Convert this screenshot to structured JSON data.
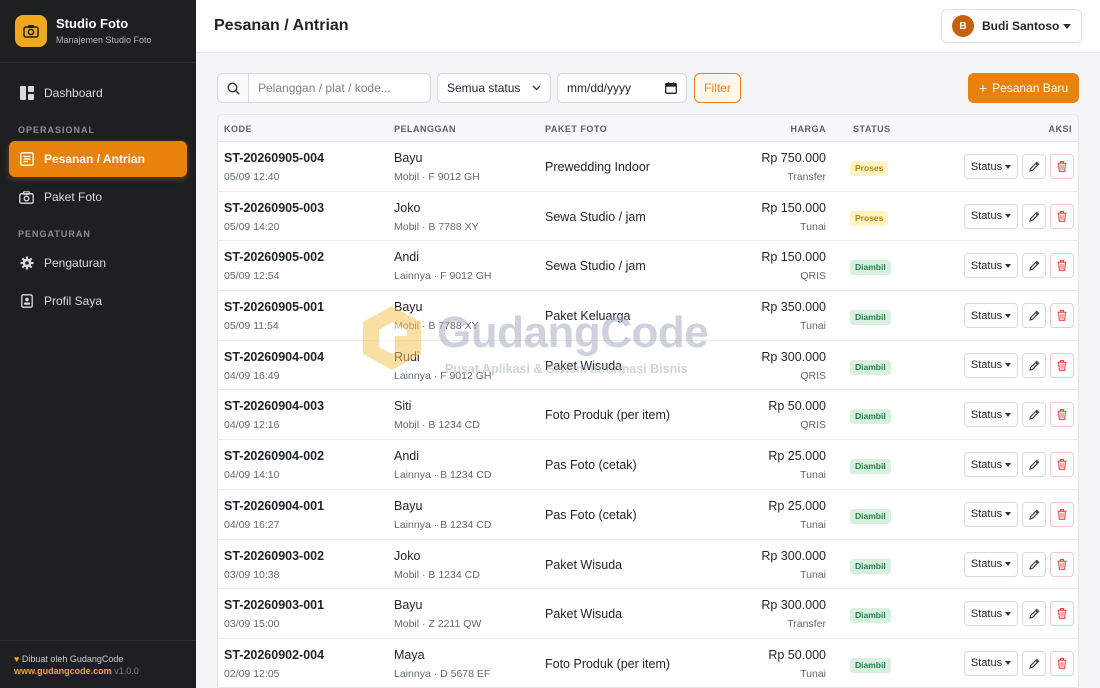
{
  "brand": {
    "title": "Studio Foto",
    "subtitle": "Manajemen Studio Foto",
    "color": "#f0a81e"
  },
  "sidebar": {
    "items": [
      {
        "label": "Dashboard",
        "icon": "dashboard-icon"
      }
    ],
    "section_operasional": "OPERASIONAL",
    "operasional": [
      {
        "label": "Pesanan / Antrian",
        "icon": "list-icon",
        "active": true
      },
      {
        "label": "Paket Foto",
        "icon": "camera-icon"
      }
    ],
    "section_pengaturan": "PENGATURAN",
    "pengaturan": [
      {
        "label": "Pengaturan",
        "icon": "gear-icon"
      },
      {
        "label": "Profil Saya",
        "icon": "id-badge-icon"
      }
    ],
    "footer": {
      "made_by": "Dibuat oleh GudangCode",
      "site": "www.gudangcode.com",
      "version": "v1.0.0"
    }
  },
  "header": {
    "title": "Pesanan / Antrian",
    "user": {
      "initial": "B",
      "name": "Budi Santoso"
    }
  },
  "filters": {
    "search_placeholder": "Pelanggan / plat / kode...",
    "status_value": "Semua status",
    "date_value": "mm/dd/yyyy",
    "filter_label": "Filter",
    "new_label": "Pesanan Baru",
    "accent": "#e8820c"
  },
  "table": {
    "columns": {
      "code": "KODE",
      "customer": "PELANGGAN",
      "package": "PAKET FOTO",
      "price": "HARGA",
      "status": "STATUS",
      "action": "AKSI"
    },
    "status_button": "Status",
    "rows": [
      {
        "code": "ST-20260905-004",
        "datetime": "05/09 12:40",
        "customer": "Bayu",
        "vehicle": "Mobil · F 9012 GH",
        "package": "Prewedding Indoor",
        "price": "Rp 750.000",
        "payment": "Transfer",
        "status": "Proses",
        "status_type": "proses"
      },
      {
        "code": "ST-20260905-003",
        "datetime": "05/09 14:20",
        "customer": "Joko",
        "vehicle": "Mobil · B 7788 XY",
        "package": "Sewa Studio / jam",
        "price": "Rp 150.000",
        "payment": "Tunai",
        "status": "Proses",
        "status_type": "proses"
      },
      {
        "code": "ST-20260905-002",
        "datetime": "05/09 12:54",
        "customer": "Andi",
        "vehicle": "Lainnya · F 9012 GH",
        "package": "Sewa Studio / jam",
        "price": "Rp 150.000",
        "payment": "QRIS",
        "status": "Diambil",
        "status_type": "diambil"
      },
      {
        "code": "ST-20260905-001",
        "datetime": "05/09 11:54",
        "customer": "Bayu",
        "vehicle": "Mobil · B 7788 XY",
        "package": "Paket Keluarga",
        "price": "Rp 350.000",
        "payment": "Tunai",
        "status": "Diambil",
        "status_type": "diambil"
      },
      {
        "code": "ST-20260904-004",
        "datetime": "04/09 16:49",
        "customer": "Rudi",
        "vehicle": "Lainnya · F 9012 GH",
        "package": "Paket Wisuda",
        "price": "Rp 300.000",
        "payment": "QRIS",
        "status": "Diambil",
        "status_type": "diambil"
      },
      {
        "code": "ST-20260904-003",
        "datetime": "04/09 12:16",
        "customer": "Siti",
        "vehicle": "Mobil · B 1234 CD",
        "package": "Foto Produk (per item)",
        "price": "Rp 50.000",
        "payment": "QRIS",
        "status": "Diambil",
        "status_type": "diambil"
      },
      {
        "code": "ST-20260904-002",
        "datetime": "04/09 14:10",
        "customer": "Andi",
        "vehicle": "Lainnya · B 1234 CD",
        "package": "Pas Foto (cetak)",
        "price": "Rp 25.000",
        "payment": "Tunai",
        "status": "Diambil",
        "status_type": "diambil"
      },
      {
        "code": "ST-20260904-001",
        "datetime": "04/09 16:27",
        "customer": "Bayu",
        "vehicle": "Lainnya · B 1234 CD",
        "package": "Pas Foto (cetak)",
        "price": "Rp 25.000",
        "payment": "Tunai",
        "status": "Diambil",
        "status_type": "diambil"
      },
      {
        "code": "ST-20260903-002",
        "datetime": "03/09 10:38",
        "customer": "Joko",
        "vehicle": "Mobil · B 1234 CD",
        "package": "Paket Wisuda",
        "price": "Rp 300.000",
        "payment": "Tunai",
        "status": "Diambil",
        "status_type": "diambil"
      },
      {
        "code": "ST-20260903-001",
        "datetime": "03/09 15:00",
        "customer": "Bayu",
        "vehicle": "Mobil · Z 2211 QW",
        "package": "Paket Wisuda",
        "price": "Rp 300.000",
        "payment": "Transfer",
        "status": "Diambil",
        "status_type": "diambil"
      },
      {
        "code": "ST-20260902-004",
        "datetime": "02/09 12:05",
        "customer": "Maya",
        "vehicle": "Lainnya · D 5678 EF",
        "package": "Foto Produk (per item)",
        "price": "Rp 50.000",
        "payment": "Tunai",
        "status": "Diambil",
        "status_type": "diambil"
      }
    ]
  },
  "watermark": {
    "title": "GudangCode",
    "subtitle": "Pusat Aplikasi & Sistem Informasi Bisnis"
  }
}
